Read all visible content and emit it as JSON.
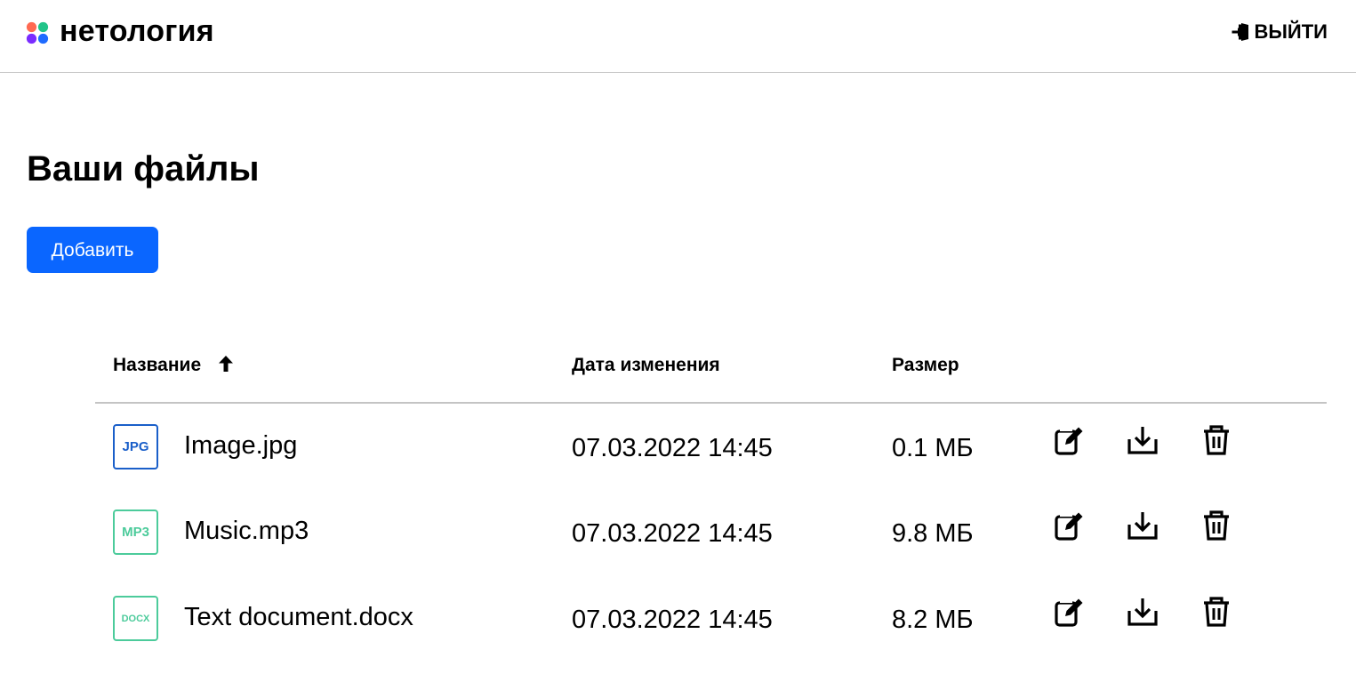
{
  "header": {
    "brand": "нетология",
    "logo_colors": [
      "#ff6a52",
      "#22c489",
      "#7a2cff",
      "#1f6bff"
    ],
    "logout_label": "ВЫЙТИ",
    "logout_icon": "logout-icon"
  },
  "main": {
    "title": "Ваши файлы",
    "add_label": "Добавить",
    "accent": "#0a66ff"
  },
  "table": {
    "columns": {
      "name": "Название",
      "date": "Дата изменения",
      "size": "Размер"
    },
    "sort_icon": "arrow-up-icon",
    "rows": [
      {
        "type_label": "JPG",
        "type_color": "#1a5fc9",
        "name": "Image.jpg",
        "modified": "07.03.2022 14:45",
        "size": "0.1 МБ"
      },
      {
        "type_label": "MP3",
        "type_color": "#4ccb9b",
        "name": "Music.mp3",
        "modified": "07.03.2022 14:45",
        "size": "9.8 МБ"
      },
      {
        "type_label": "DOCX",
        "type_color": "#4ccb9b",
        "name": "Text document.docx",
        "modified": "07.03.2022 14:45",
        "size": "8.2 МБ"
      }
    ],
    "row_actions": [
      "edit-icon",
      "download-icon",
      "trash-icon"
    ]
  }
}
